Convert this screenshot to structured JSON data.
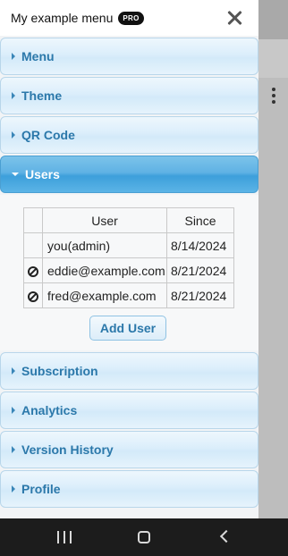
{
  "header": {
    "title": "My example menu",
    "badge": "PRO"
  },
  "sections_before": [
    {
      "label": "Menu"
    },
    {
      "label": "Theme"
    },
    {
      "label": "QR Code"
    }
  ],
  "open_section": {
    "label": "Users"
  },
  "users_table": {
    "columns": [
      "",
      "User",
      "Since"
    ],
    "rows": [
      {
        "icon": "",
        "user": "you(admin)",
        "since": "8/14/2024"
      },
      {
        "icon": "ban-icon",
        "user": "eddie@example.com",
        "since": "8/21/2024"
      },
      {
        "icon": "ban-icon",
        "user": "fred@example.com",
        "since": "8/21/2024"
      }
    ],
    "add_button": "Add User"
  },
  "sections_after": [
    {
      "label": "Subscription"
    },
    {
      "label": "Analytics"
    },
    {
      "label": "Version History"
    },
    {
      "label": "Profile"
    }
  ],
  "colors": {
    "accent": "#2b78aa",
    "open_section": "#3d9fdb",
    "nav_bar": "#1c1c1c"
  },
  "icons": {
    "close": "close-icon",
    "overflow": "kebab-icon",
    "nav": [
      "recents-icon",
      "home-icon",
      "back-icon"
    ]
  }
}
